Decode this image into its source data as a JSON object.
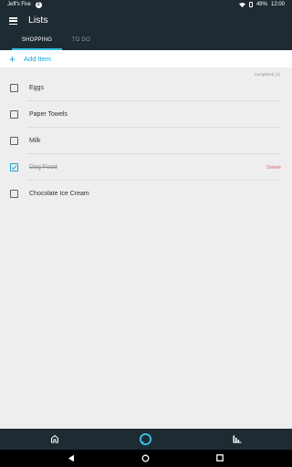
{
  "status_bar": {
    "device_name": "Jeff's Fire",
    "notification_count": "2",
    "battery": "49%",
    "time": "12:00"
  },
  "app_bar": {
    "title": "Lists",
    "tabs": [
      {
        "label": "SHOPPING",
        "active": true
      },
      {
        "label": "TO DO",
        "active": false
      }
    ]
  },
  "add_item": {
    "label": "Add Item"
  },
  "completed_label": "Completed (1)",
  "items": [
    {
      "label": "Eggs",
      "checked": false
    },
    {
      "label": "Paper Towels",
      "checked": false
    },
    {
      "label": "Milk",
      "checked": false
    },
    {
      "label": "Dog Food",
      "checked": true,
      "action": "Delete"
    },
    {
      "label": "Chocolate Ice Cream",
      "checked": false
    }
  ],
  "bottom_nav": {
    "icons": [
      "home-icon",
      "alexa-icon",
      "chart-icon"
    ]
  },
  "system_nav": {
    "icons": [
      "back-icon",
      "home-icon",
      "recents-icon"
    ]
  },
  "colors": {
    "app_bar": "#1f2b33",
    "accent": "#1aa3d4",
    "tab_indicator": "#35c2e8",
    "delete": "#e85b6a",
    "background": "#eeeeee"
  }
}
